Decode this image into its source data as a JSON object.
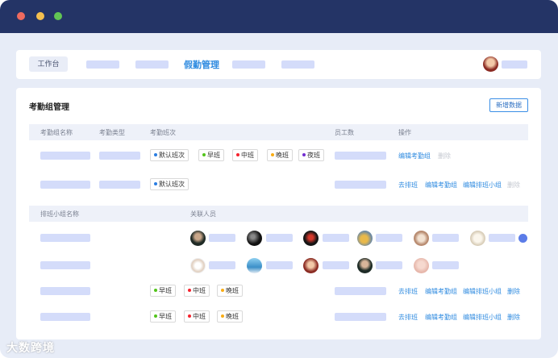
{
  "nav": {
    "home_label": "工作台",
    "active_tab": "假勤管理"
  },
  "section": {
    "title": "考勤组管理",
    "add_button": "新增数据"
  },
  "table1": {
    "headers": [
      "考勤组名称",
      "考勤类型",
      "考勤班次",
      "员工数",
      "操作"
    ],
    "row1": {
      "shifts": [
        {
          "label": "默认班次",
          "color": "#2a7de1"
        },
        {
          "label": "早班",
          "color": "#52c41a"
        },
        {
          "label": "中班",
          "color": "#f5222d"
        },
        {
          "label": "晚班",
          "color": "#faad14"
        },
        {
          "label": "夜班",
          "color": "#722ed1"
        }
      ],
      "actions": [
        "编辑考勤组",
        "删除"
      ]
    },
    "row2": {
      "shifts": [
        {
          "label": "默认班次",
          "color": "#2a7de1"
        }
      ],
      "actions": [
        "去排班",
        "编辑考勤组",
        "编辑排班小组",
        "删除"
      ]
    }
  },
  "table2": {
    "headers": [
      "排班小组名称",
      "关联人员"
    ],
    "row3": {
      "shifts": [
        {
          "label": "早班",
          "color": "#52c41a"
        },
        {
          "label": "中班",
          "color": "#f5222d"
        },
        {
          "label": "晚班",
          "color": "#faad14"
        }
      ],
      "actions": [
        "去排班",
        "编辑考勤组",
        "编辑排班小组",
        "删除"
      ]
    },
    "row4": {
      "shifts": [
        {
          "label": "早班",
          "color": "#52c41a"
        },
        {
          "label": "中班",
          "color": "#f5222d"
        },
        {
          "label": "晚班",
          "color": "#faad14"
        }
      ],
      "actions": [
        "去排班",
        "编辑考勤组",
        "编辑排班小组",
        "删除"
      ]
    }
  },
  "watermark": "大数跨境",
  "colors": {
    "titlebar": "#243466",
    "placeholder": "#d4dcfa",
    "accent": "#2f8be0"
  }
}
